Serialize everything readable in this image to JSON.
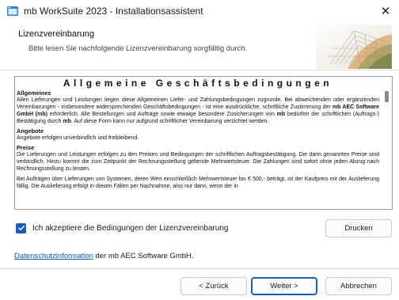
{
  "window": {
    "title": "mb WorkSuite 2023 - Installationsassistent",
    "close_glyph": "✕"
  },
  "header": {
    "title": "Lizenzvereinbarung",
    "subtitle": "Bitte lesen Sie nachfolgende Lizenzvereinbarung sorgfältig durch."
  },
  "license": {
    "doc_title": "Allgemeine Geschäftsbedingungen",
    "sections": [
      {
        "heading": "Allgemeines",
        "text_a": "Allen Lieferungen und Leistungen liegen diese Allgemeinen Liefer- und Zahlungsbedingungen zugrunde. Bei abweichenden oder ergänzenden Vereinbarungen - insbesondere widersprechenden Geschäftsbedingungen - ist eine ausdrückliche, schriftliche Zustimmung der ",
        "bold_a": "mb AEC Software GmbH (mb)",
        "text_b": " erforderlich. Alle Bestellungen und Aufträge sowie etwaige besondere Zusicherungen von ",
        "bold_b": "mb",
        "text_c": " bedürfen der schriftlichen (Auftrags-) Bestätigung durch ",
        "bold_c": "mb",
        "text_d": ". Auf diese Form kann nur aufgrund schriftlicher Vereinbarung verzichtet werden."
      },
      {
        "heading": "Angebote",
        "text": "Angebote erfolgen unverbindlich und freibleibend."
      },
      {
        "heading": "Preise",
        "text": "Die Lieferungen und Leistungen erfolgen zu den Preisen und Bedingungen der schriftlichen Auftragsbestätigung. Die darin genannten Preise sind verbindlich. Hinzu kommt die zum Zeitpunkt der Rechnungsstellung geltende Mehrwertsteuer. Die Zahlungen sind sofort ohne jeden Abzug nach Rechnungsstellung zu leisten.",
        "text2": "Bei Aufträgen über Lieferungen von Systemen, deren Wert einschließlich Mehrwertsteuer bis € 500,- beträgt, ist der Kaufpreis mit der Auslieferung fällig. Die Auslieferung erfolgt in diesen Fällen per Nachnahme, also nur dann, wenn der in"
      }
    ]
  },
  "agree": {
    "checked": true,
    "label": "Ich akzeptiere die Bedingungen der Lizenzvereinbarung"
  },
  "buttons": {
    "print": "Drucken",
    "back": "< Zurück",
    "next": "Weiter >",
    "cancel": "Abbrechen"
  },
  "privacy": {
    "link_text": "Datenschutzinformation",
    "suffix": " der mb AEC Software GmbH."
  },
  "colors": {
    "accent": "#1a5fb4",
    "link": "#0b5cad"
  },
  "icons": {
    "app": "app-window-icon",
    "close": "close-icon",
    "check": "checkmark-icon",
    "logo": "architecture-logo-icon"
  }
}
